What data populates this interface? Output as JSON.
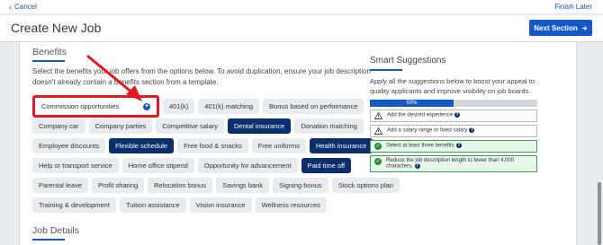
{
  "topbar": {
    "cancel_label": "Cancel",
    "finish_label": "Finish Later"
  },
  "header": {
    "title": "Create New Job",
    "next_label": "Next Section"
  },
  "benefits": {
    "heading": "Benefits",
    "intro": "Select the benefits your job offers from the options below. To avoid duplication, ensure your job description doesn't already contain a benefits section from a template.",
    "rows": [
      [
        {
          "label": "Commission opportunities",
          "selected": false,
          "highlighted": true
        },
        {
          "label": "401(k)",
          "selected": false
        },
        {
          "label": "401(k) matching",
          "selected": false
        },
        {
          "label": "Bonus based on performance",
          "selected": false
        }
      ],
      [
        {
          "label": "Company car",
          "selected": false
        },
        {
          "label": "Company parties",
          "selected": false
        },
        {
          "label": "Competitive salary",
          "selected": false
        },
        {
          "label": "Dental insurance",
          "selected": true
        },
        {
          "label": "Donation matching",
          "selected": false
        }
      ],
      [
        {
          "label": "Employee discounts",
          "selected": false
        },
        {
          "label": "Flexible schedule",
          "selected": true
        },
        {
          "label": "Free food & snacks",
          "selected": false
        },
        {
          "label": "Free uniforms",
          "selected": false
        },
        {
          "label": "Health insurance",
          "selected": true
        }
      ],
      [
        {
          "label": "Help or transport service",
          "selected": false
        },
        {
          "label": "Home office stipend",
          "selected": false
        },
        {
          "label": "Opportunity for advancement",
          "selected": false
        },
        {
          "label": "Paid time off",
          "selected": true
        }
      ],
      [
        {
          "label": "Parental leave",
          "selected": false
        },
        {
          "label": "Profit sharing",
          "selected": false
        },
        {
          "label": "Relocation bonus",
          "selected": false
        },
        {
          "label": "Savings bank",
          "selected": false
        },
        {
          "label": "Signing bonus",
          "selected": false
        },
        {
          "label": "Stock options plan",
          "selected": false
        }
      ],
      [
        {
          "label": "Training & development",
          "selected": false
        },
        {
          "label": "Tuition assistance",
          "selected": false
        },
        {
          "label": "Vision insurance",
          "selected": false
        },
        {
          "label": "Wellness resources",
          "selected": false
        }
      ]
    ]
  },
  "job_details": {
    "heading": "Job Details"
  },
  "smart": {
    "title": "Smart Suggestions",
    "description": "Apply all the suggestions below to boost your appeal to quality applicants and improve visibility on job boards.",
    "progress_label": "50%",
    "progress_value": 0.5,
    "items": [
      {
        "text": "Add the desired experience",
        "status": "warning"
      },
      {
        "text": "Add a salary range or fixed salary",
        "status": "warning"
      },
      {
        "text": "Select at least three benefits",
        "status": "done"
      },
      {
        "text": "Reduce the job description length to fewer than 4,000 characters.",
        "status": "done"
      }
    ]
  },
  "colors": {
    "accent": "#1358c9",
    "selected_chip": "#0b2e6c",
    "annotation": "#e01a22",
    "success": "#2e8b3c"
  }
}
